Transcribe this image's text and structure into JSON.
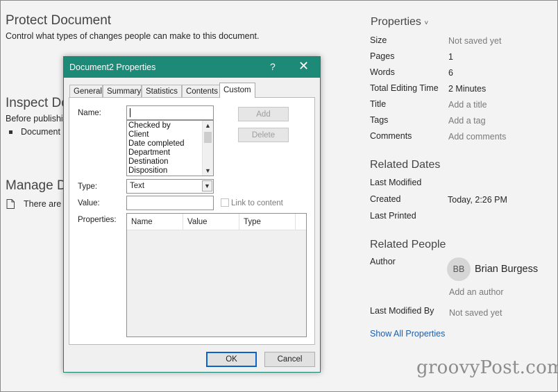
{
  "left": {
    "protect": {
      "title": "Protect Document",
      "desc": "Control what types of changes people can make to this document."
    },
    "inspect": {
      "title": "Inspect Do",
      "desc": "Before publishi",
      "bullet": "Document"
    },
    "manage": {
      "title": "Manage D",
      "desc": "There are n"
    }
  },
  "properties": {
    "heading": "Properties",
    "rows": [
      {
        "label": "Size",
        "value": "Not saved yet"
      },
      {
        "label": "Pages",
        "value": "1"
      },
      {
        "label": "Words",
        "value": "6"
      },
      {
        "label": "Total Editing Time",
        "value": "2 Minutes"
      },
      {
        "label": "Title",
        "value": "Add a title"
      },
      {
        "label": "Tags",
        "value": "Add a tag"
      },
      {
        "label": "Comments",
        "value": "Add comments"
      }
    ],
    "dates_heading": "Related Dates",
    "dates": [
      {
        "label": "Last Modified",
        "value": ""
      },
      {
        "label": "Created",
        "value": "Today, 2:26 PM"
      },
      {
        "label": "Last Printed",
        "value": ""
      }
    ],
    "people_heading": "Related People",
    "author_label": "Author",
    "author_initials": "BB",
    "author_name": "Brian Burgess",
    "add_author": "Add an author",
    "last_modified_by_label": "Last Modified By",
    "last_modified_by_value": "Not saved yet",
    "show_all": "Show All Properties"
  },
  "dialog": {
    "title": "Document2 Properties",
    "help": "?",
    "close": "✕",
    "tabs": [
      "General",
      "Summary",
      "Statistics",
      "Contents",
      "Custom"
    ],
    "active_tab": "Custom",
    "name_label": "Name:",
    "name_value": "",
    "name_options": [
      "Checked by",
      "Client",
      "Date completed",
      "Department",
      "Destination",
      "Disposition"
    ],
    "add_button": "Add",
    "delete_button": "Delete",
    "type_label": "Type:",
    "type_value": "Text",
    "value_label": "Value:",
    "value_value": "",
    "link_label": "Link to content",
    "properties_label": "Properties:",
    "columns": [
      "Name",
      "Value",
      "Type"
    ],
    "ok_button": "OK",
    "cancel_button": "Cancel"
  },
  "watermark": "groovyPost.com",
  "colors": {
    "titlebar": "#1d8a78",
    "link": "#1f5ea6",
    "default_button_border": "#0a64c8"
  }
}
